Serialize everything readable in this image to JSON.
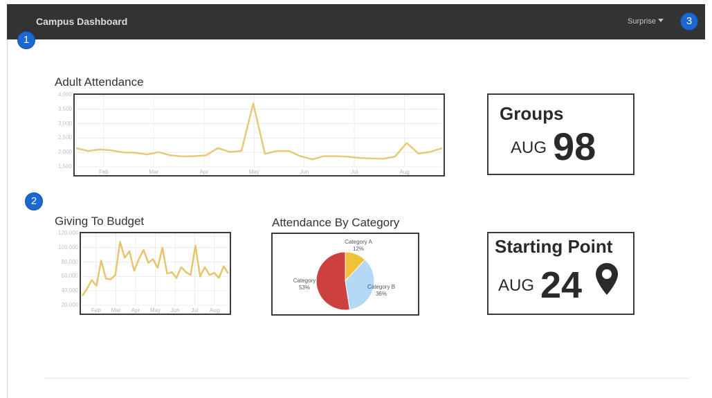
{
  "header": {
    "title": "Campus Dashboard",
    "menu_label": "Surprise"
  },
  "badges": [
    "1",
    "2",
    "3"
  ],
  "widgets": {
    "adult_attendance": {
      "title": "Adult Attendance"
    },
    "giving": {
      "title": "Giving To Budget"
    },
    "category": {
      "title": "Attendance By Category"
    },
    "groups": {
      "title": "Groups",
      "month": "AUG",
      "value": "98"
    },
    "starting_point": {
      "title": "Starting Point",
      "month": "AUG",
      "value": "24",
      "icon": "map-marker-icon"
    }
  },
  "colors": {
    "line": "#e8c97a",
    "line2": "#e8c56a",
    "topbar": "#333333",
    "badge": "#1b68d0"
  },
  "chart_data": [
    {
      "type": "line",
      "title": "Adult Attendance",
      "x_ticks": [
        "Feb",
        "Mar",
        "Apr",
        "May",
        "Jun",
        "Jul",
        "Aug"
      ],
      "y_ticks": [
        "1,500",
        "2,000",
        "2,500",
        "3,000",
        "3,500",
        "4,000"
      ],
      "ylim": [
        1500,
        4000
      ],
      "grid": true,
      "values": [
        2150,
        2050,
        2100,
        2070,
        2000,
        1990,
        1930,
        2010,
        1900,
        1860,
        1870,
        1900,
        2150,
        2020,
        2050,
        3700,
        1950,
        2050,
        2050,
        1870,
        1760,
        1870,
        1870,
        1850,
        1810,
        1790,
        1780,
        1850,
        2330,
        1960,
        2020,
        2150
      ]
    },
    {
      "type": "line",
      "title": "Giving To Budget",
      "x_ticks": [
        "Feb",
        "Mar",
        "Apr",
        "May",
        "Jun",
        "Jul",
        "Aug"
      ],
      "y_ticks": [
        "20,000",
        "40,000",
        "60,000",
        "80,000",
        "100,000",
        "120,000"
      ],
      "ylim": [
        20000,
        120000
      ],
      "grid": true,
      "values": [
        33000,
        43000,
        55000,
        47000,
        82000,
        57000,
        56000,
        62000,
        108000,
        86000,
        95000,
        68000,
        84000,
        97000,
        79000,
        84000,
        72000,
        100000,
        64000,
        66000,
        58000,
        73000,
        66000,
        62000,
        103000,
        60000,
        73000,
        62000,
        65000,
        58000,
        74000,
        64000
      ]
    },
    {
      "type": "pie",
      "title": "Attendance By Category",
      "slices": [
        {
          "label": "Category A",
          "pct": "12%",
          "value": 12,
          "color": "#f0c23a"
        },
        {
          "label": "Category B",
          "pct": "36%",
          "value": 36,
          "color": "#b5d8f5"
        },
        {
          "label": "Category",
          "pct": "53%",
          "value": 53,
          "color": "#cd4040"
        }
      ]
    }
  ]
}
